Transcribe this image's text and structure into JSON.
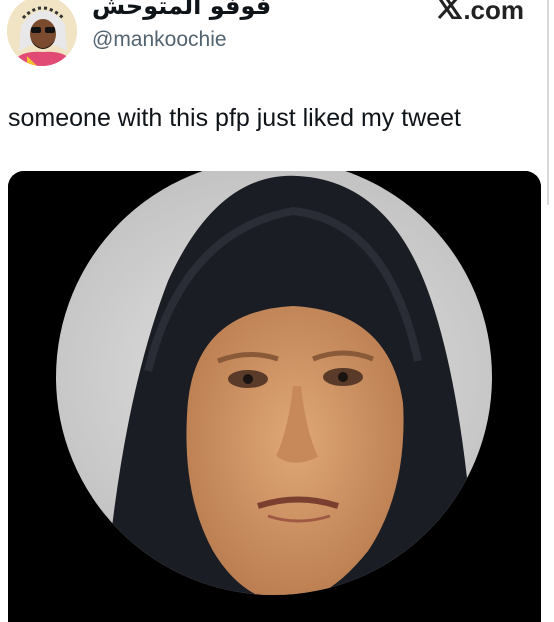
{
  "tweet": {
    "display_name": "فوفو المتوحش",
    "handle": "@mankoochie",
    "brand": ".com",
    "brand_icon": "x-logo-icon",
    "text": "someone with this pfp just liked my tweet"
  },
  "colors": {
    "text_primary": "#0f1419",
    "text_secondary": "#536471",
    "media_background": "#000000"
  }
}
